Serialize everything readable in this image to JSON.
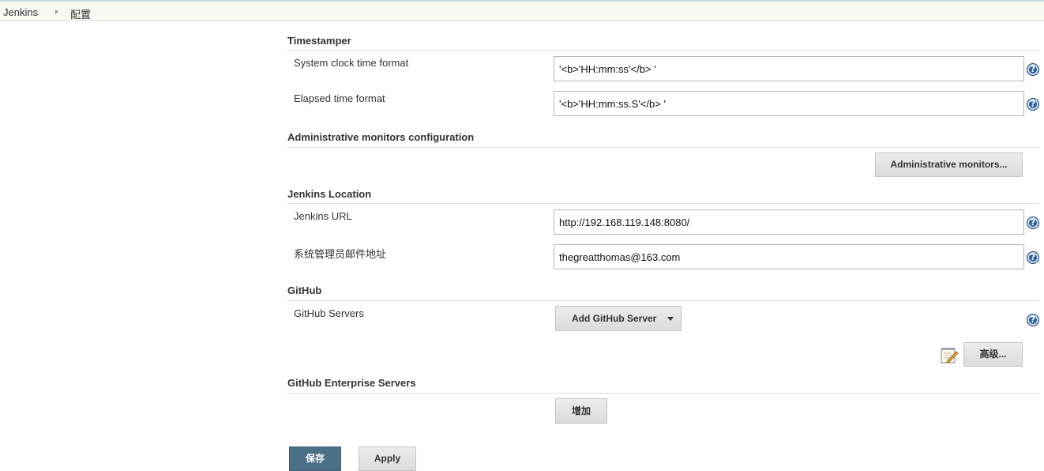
{
  "breadcrumb": {
    "root": "Jenkins",
    "current": "配置"
  },
  "timestamper": {
    "title": "Timestamper",
    "system_clock_label": "System clock time format",
    "system_clock_value": "'<b>'HH:mm:ss'</b> '",
    "elapsed_label": "Elapsed time format",
    "elapsed_value": "'<b>'HH:mm:ss.S'</b> '"
  },
  "admin_monitors": {
    "title": "Administrative monitors configuration",
    "button_label": "Administrative monitors..."
  },
  "location": {
    "title": "Jenkins Location",
    "url_label": "Jenkins URL",
    "url_value": "http://192.168.119.148:8080/",
    "email_label": "系统管理员邮件地址",
    "email_value": "thegreatthomas@163.com"
  },
  "github": {
    "title": "GitHub",
    "servers_label": "GitHub Servers",
    "add_server_label": "Add GitHub Server",
    "advanced_label": "高级..."
  },
  "github_enterprise": {
    "title": "GitHub Enterprise Servers",
    "add_label": "增加"
  },
  "footer": {
    "save_label": "保存",
    "apply_label": "Apply"
  },
  "icons": {
    "help": "help-icon",
    "breadcrumb_separator": "chevron-right-icon",
    "dropdown": "caret-down-icon",
    "advanced": "notepad-edit-icon"
  },
  "help_glyph": "?",
  "colors": {
    "primary_button": "#4a7088",
    "help_icon": "#2d5f9a"
  }
}
